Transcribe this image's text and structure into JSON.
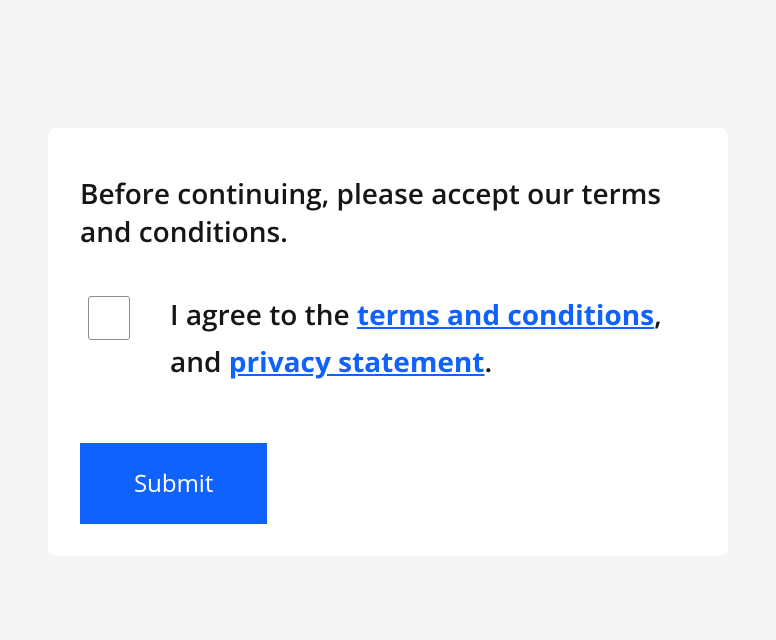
{
  "instruction": "Before continuing, please accept our terms and conditions.",
  "checkbox": {
    "label_prefix": "I agree to the ",
    "terms_link": "terms and conditions",
    "separator1": ", and ",
    "privacy_link": "privacy statement",
    "suffix": "."
  },
  "submit_label": "Submit"
}
